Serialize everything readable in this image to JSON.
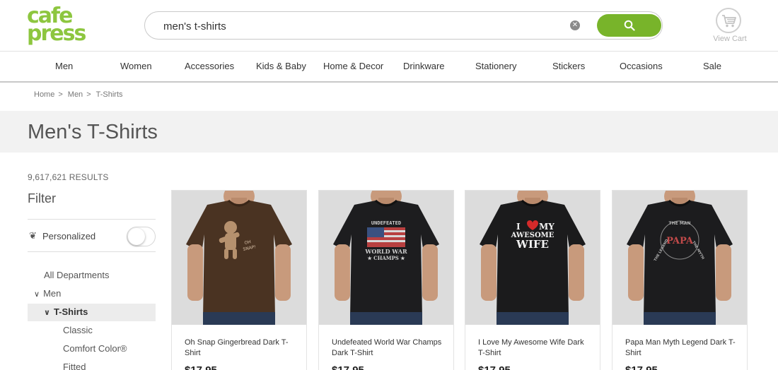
{
  "brand": {
    "line1": "cafe",
    "line2": "press",
    "color": "#8dc63f"
  },
  "search": {
    "value": "men's t-shirts",
    "placeholder": "Search",
    "button_color": "#78b42a",
    "clear_icon": "close-circle-icon",
    "search_icon": "magnifier-icon"
  },
  "cart": {
    "label": "View Cart",
    "icon": "cart-icon"
  },
  "nav": {
    "items": [
      "Men",
      "Women",
      "Accessories",
      "Kids & Baby",
      "Home & Decor",
      "Drinkware",
      "Stationery",
      "Stickers",
      "Occasions",
      "Sale"
    ]
  },
  "breadcrumb": {
    "items": [
      "Home",
      "Men",
      "T-Shirts"
    ],
    "separator": ">"
  },
  "page": {
    "title": "Men's T-Shirts"
  },
  "filters": {
    "results_count": "9,617,621 RESULTS",
    "heading": "Filter",
    "personalized": {
      "label": "Personalized",
      "icon": "personalize-icon",
      "toggle_on": false
    },
    "departments": {
      "all": "All Departments",
      "men": "Men",
      "selected": "T-Shirts",
      "sub": [
        "Classic",
        "Comfort Color®",
        "Fitted"
      ]
    }
  },
  "products": [
    {
      "name": "Oh Snap Gingerbread Dark T-Shirt",
      "price": "$17.95",
      "shirt_color": "#4a3322",
      "print": "gingerbread",
      "print_text": [
        "OH",
        "SNAP!"
      ]
    },
    {
      "name": "Undefeated World War Champs Dark T-Shirt",
      "price": "$17.95",
      "shirt_color": "#1d1d1f",
      "print": "flag",
      "print_text": [
        "UNDEFEATED",
        "WORLD WAR",
        "★ CHAMPS ★"
      ]
    },
    {
      "name": "I Love My Awesome Wife Dark T-Shirt",
      "price": "$17.95",
      "shirt_color": "#1b1b1c",
      "print": "wife",
      "print_text": [
        "I",
        "MY",
        "AWESOME",
        "WIFE"
      ]
    },
    {
      "name": "Papa Man Myth Legend Dark T-Shirt",
      "price": "$17.95",
      "shirt_color": "#1c1c1e",
      "print": "papa",
      "print_text": [
        "THE MAN",
        "PAPA",
        "THE MYTH",
        "THE LEGEND"
      ]
    }
  ]
}
